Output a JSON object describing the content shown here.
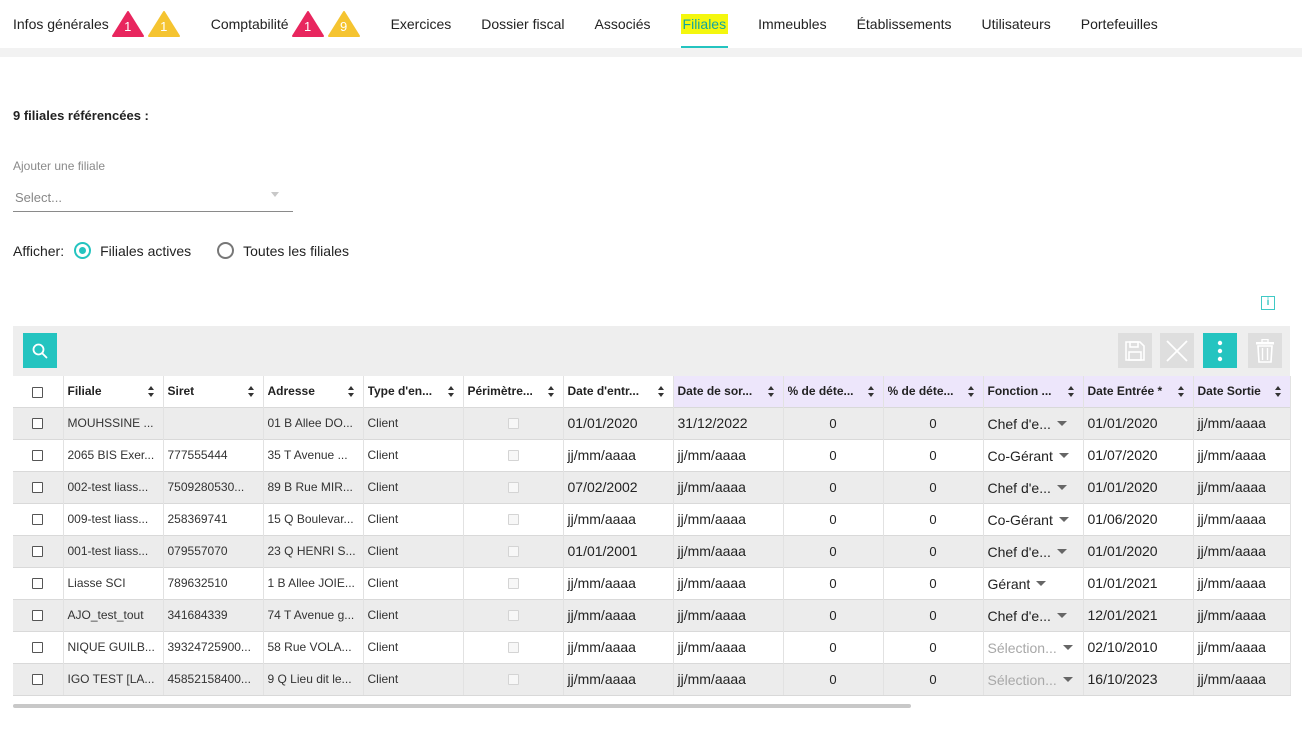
{
  "tabs": [
    {
      "label": "Infos générales",
      "badges": [
        {
          "color": "#e8265e",
          "value": "1"
        },
        {
          "color": "#f5c431",
          "value": "1"
        }
      ]
    },
    {
      "label": "Comptabilité",
      "badges": [
        {
          "color": "#e8265e",
          "value": "1"
        },
        {
          "color": "#f5c431",
          "value": "9"
        }
      ]
    },
    {
      "label": "Exercices",
      "badges": []
    },
    {
      "label": "Dossier fiscal",
      "badges": []
    },
    {
      "label": "Associés",
      "badges": []
    },
    {
      "label": "Filiales",
      "badges": [],
      "active": true
    },
    {
      "label": "Immeubles",
      "badges": []
    },
    {
      "label": "Établissements",
      "badges": []
    },
    {
      "label": "Utilisateurs",
      "badges": []
    },
    {
      "label": "Portefeuilles",
      "badges": []
    }
  ],
  "header": {
    "count_title": "9 filiales référencées :",
    "add_label": "Ajouter une filiale",
    "select_placeholder": "Select...",
    "show_label": "Afficher:",
    "option_active": "Filiales actives",
    "option_all": "Toutes les filiales"
  },
  "colors": {
    "accent": "#24c4c0",
    "highlight": "#f4f70e",
    "badge_red": "#e8265e",
    "badge_yellow": "#f5c431",
    "lavender": "#ede6fb"
  },
  "toolbar": {
    "icons": [
      "search-icon",
      "save-icon",
      "cancel-icon",
      "more-icon",
      "delete-icon"
    ]
  },
  "table": {
    "columns": [
      {
        "key": "filiale",
        "label": "Filiale",
        "lav": false
      },
      {
        "key": "siret",
        "label": "Siret",
        "lav": false
      },
      {
        "key": "adresse",
        "label": "Adresse",
        "lav": false
      },
      {
        "key": "type",
        "label": "Type d'en...",
        "lav": false
      },
      {
        "key": "perimetre",
        "label": "Périmètre...",
        "lav": false
      },
      {
        "key": "date_entree_pct",
        "label": "Date d'entr...",
        "lav": false
      },
      {
        "key": "date_sortie_pct",
        "label": "Date de sor...",
        "lav": true
      },
      {
        "key": "pct1",
        "label": "% de déte...",
        "lav": true
      },
      {
        "key": "pct2",
        "label": "% de déte...",
        "lav": true
      },
      {
        "key": "fonction",
        "label": "Fonction ...",
        "lav": true
      },
      {
        "key": "date_entree",
        "label": "Date Entrée *",
        "lav": true
      },
      {
        "key": "date_sortie",
        "label": "Date Sortie",
        "lav": true
      }
    ],
    "rows": [
      {
        "filiale": "MOUHSSINE ...",
        "siret": "",
        "adresse": "01 B Allee DO...",
        "type": "Client",
        "d1": "01/01/2020",
        "d2": "31/12/2022",
        "p1": "0",
        "p2": "0",
        "fonction": "Chef d'e...",
        "fn_ph": false,
        "de": "01/01/2020",
        "ds": "jj/mm/aaaa"
      },
      {
        "filiale": "2065 BIS Exer...",
        "siret": "777555444",
        "adresse": "35 T Avenue ...",
        "type": "Client",
        "d1": "jj/mm/aaaa",
        "d2": "jj/mm/aaaa",
        "p1": "0",
        "p2": "0",
        "fonction": "Co-Gérant",
        "fn_ph": false,
        "de": "01/07/2020",
        "ds": "jj/mm/aaaa"
      },
      {
        "filiale": "002-test liass...",
        "siret": "7509280530...",
        "adresse": "89 B Rue MIR...",
        "type": "Client",
        "d1": "07/02/2002",
        "d2": "jj/mm/aaaa",
        "p1": "0",
        "p2": "0",
        "fonction": "Chef d'e...",
        "fn_ph": false,
        "de": "01/01/2020",
        "ds": "jj/mm/aaaa"
      },
      {
        "filiale": "009-test liass...",
        "siret": "258369741",
        "adresse": "15 Q Boulevar...",
        "type": "Client",
        "d1": "jj/mm/aaaa",
        "d2": "jj/mm/aaaa",
        "p1": "0",
        "p2": "0",
        "fonction": "Co-Gérant",
        "fn_ph": false,
        "de": "01/06/2020",
        "ds": "jj/mm/aaaa"
      },
      {
        "filiale": "001-test liass...",
        "siret": "079557070",
        "adresse": "23 Q HENRI S...",
        "type": "Client",
        "d1": "01/01/2001",
        "d2": "jj/mm/aaaa",
        "p1": "0",
        "p2": "0",
        "fonction": "Chef d'e...",
        "fn_ph": false,
        "de": "01/01/2020",
        "ds": "jj/mm/aaaa"
      },
      {
        "filiale": "Liasse SCI",
        "siret": "789632510",
        "adresse": "1 B Allee JOIE...",
        "type": "Client",
        "d1": "jj/mm/aaaa",
        "d2": "jj/mm/aaaa",
        "p1": "0",
        "p2": "0",
        "fonction": "Gérant",
        "fn_ph": false,
        "de": "01/01/2021",
        "ds": "jj/mm/aaaa"
      },
      {
        "filiale": "AJO_test_tout",
        "siret": "341684339",
        "adresse": "74 T Avenue g...",
        "type": "Client",
        "d1": "jj/mm/aaaa",
        "d2": "jj/mm/aaaa",
        "p1": "0",
        "p2": "0",
        "fonction": "Chef d'e...",
        "fn_ph": false,
        "de": "12/01/2021",
        "ds": "jj/mm/aaaa"
      },
      {
        "filiale": "NIQUE GUILB...",
        "siret": "39324725900...",
        "adresse": "58 Rue VOLA...",
        "type": "Client",
        "d1": "jj/mm/aaaa",
        "d2": "jj/mm/aaaa",
        "p1": "0",
        "p2": "0",
        "fonction": "Sélection...",
        "fn_ph": true,
        "de": "02/10/2010",
        "ds": "jj/mm/aaaa"
      },
      {
        "filiale": "IGO TEST [LA...",
        "siret": "45852158400...",
        "adresse": "9 Q Lieu dit le...",
        "type": "Client",
        "d1": "jj/mm/aaaa",
        "d2": "jj/mm/aaaa",
        "p1": "0",
        "p2": "0",
        "fonction": "Sélection...",
        "fn_ph": true,
        "de": "16/10/2023",
        "ds": "jj/mm/aaaa"
      }
    ]
  }
}
